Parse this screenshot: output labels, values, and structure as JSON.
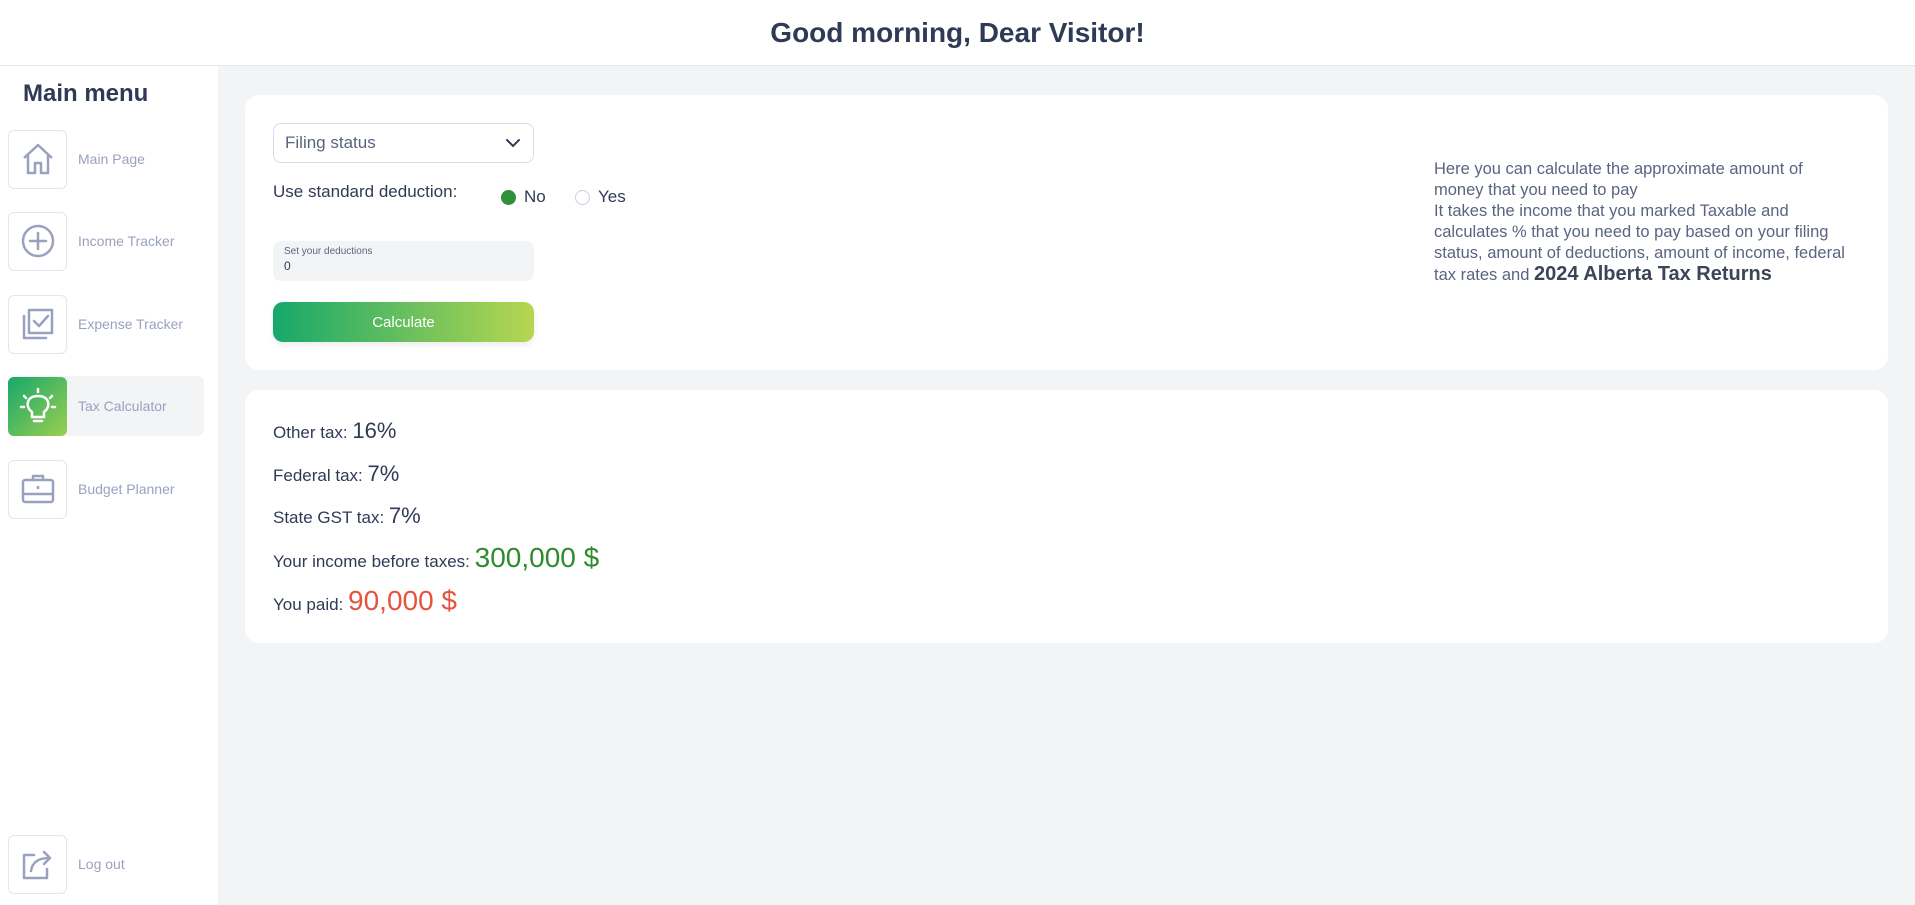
{
  "header": {
    "greeting": "Good morning, Dear Visitor!"
  },
  "sidebar": {
    "title": "Main menu",
    "items": [
      {
        "label": "Main Page",
        "icon": "home-icon"
      },
      {
        "label": "Income Tracker",
        "icon": "plus-circle-icon"
      },
      {
        "label": "Expense Tracker",
        "icon": "checkbox-icon"
      },
      {
        "label": "Tax Calculator",
        "icon": "lightbulb-icon",
        "active": true
      },
      {
        "label": "Budget Planner",
        "icon": "briefcase-icon"
      }
    ],
    "logout": {
      "label": "Log out",
      "icon": "share-icon"
    }
  },
  "form": {
    "filing_status": "Filing status",
    "deduction_label": "Use standard deduction:",
    "radio_no": "No",
    "radio_yes": "Yes",
    "radio_selected": "No",
    "deductions_label": "Set your deductions",
    "deductions_value": "0",
    "calculate": "Calculate"
  },
  "info": {
    "line1": "Here you can calculate the approximate amount of money that you need to pay",
    "line2": "It takes the income that you marked Taxable and calculates % that you need to pay based on your filing status, amount of deductions, amount of income, federal tax rates and",
    "highlight": "2024 Alberta Tax Returns"
  },
  "results": {
    "other_label": "Other tax:",
    "other_value": "16%",
    "federal_label": "Federal tax:",
    "federal_value": "7%",
    "state_label": "State GST tax:",
    "state_value": "7%",
    "income_label": "Your income before taxes:",
    "income_value": "300,000 $",
    "paid_label": "You paid:",
    "paid_value": "90,000 $"
  },
  "colors": {
    "accent_green": "#16a86b",
    "income_green": "#2e8b2e",
    "paid_red": "#e5533f",
    "text_dark": "#2f3a55",
    "nav_text": "#9aa1c0"
  }
}
